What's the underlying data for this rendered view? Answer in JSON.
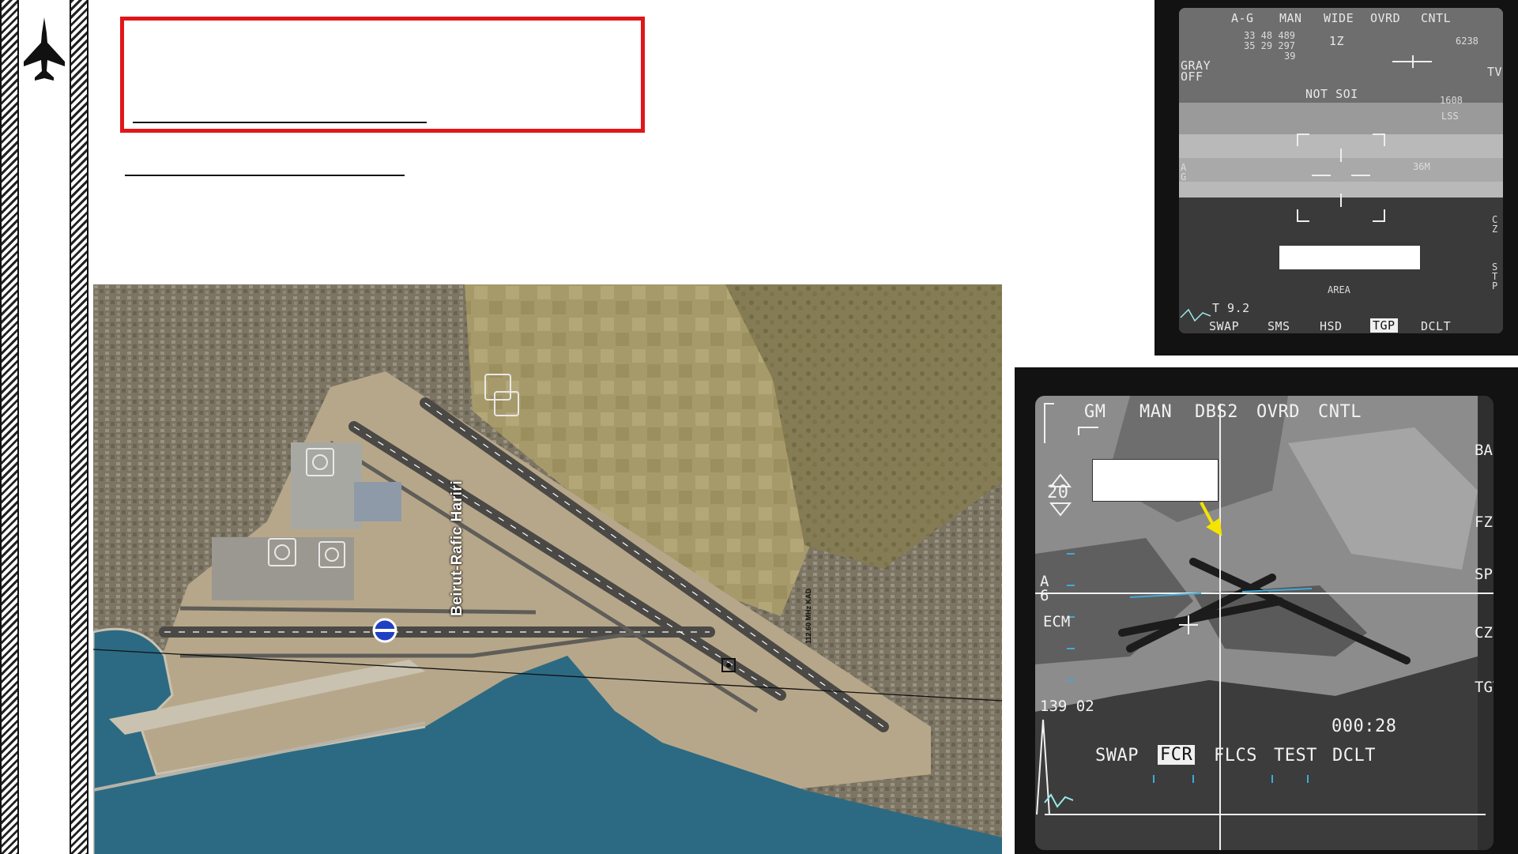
{
  "slide": {
    "title": "",
    "subtitle": ""
  },
  "map": {
    "airport_label": "Beirut-Rafic Hariri",
    "vor_label": "112.60 MHz KAD"
  },
  "tgp": {
    "top_labels": [
      "A-G",
      "MAN",
      "WIDE",
      "OVRD",
      "CNTL"
    ],
    "coords_line1": "33 48 489",
    "coords_line2": "35 29 297",
    "coords_line3": "39",
    "zoom": "1Z",
    "altitude": "6238",
    "gray_label": "GRAY",
    "off_label": "OFF",
    "tv_label": "TV",
    "not_soi": "NOT SOI",
    "range_value": "1608",
    "lss_label": "LSS",
    "target_range": "36M",
    "side_left": "A G",
    "side_right_cz": "C Z",
    "side_right_stp": "S T P",
    "area_label": "AREA",
    "time_label": "T 9.2",
    "bottom_labels": [
      "SWAP",
      "SMS",
      "HSD",
      "TGP",
      "DCLT"
    ]
  },
  "fcr": {
    "top_labels": [
      "GM",
      "MAN",
      "DBS2",
      "OVRD",
      "CNTL"
    ],
    "range_value": "20",
    "side_baro": "BARO",
    "side_fz": "FZ",
    "side_sp": "SP",
    "side_cz": "CZ",
    "side_tgt": "TGT",
    "side_ecm": "ECM",
    "side_a6": "A 6",
    "bearing_label": "139 02",
    "timer": "000:28",
    "bottom_labels": [
      "SWAP",
      "FCR",
      "FLCS",
      "TEST",
      "DCLT"
    ]
  },
  "colors": {
    "accent_red": "#e0161b",
    "arrow_yellow": "#f5e400",
    "sea": "#2c6a83"
  }
}
